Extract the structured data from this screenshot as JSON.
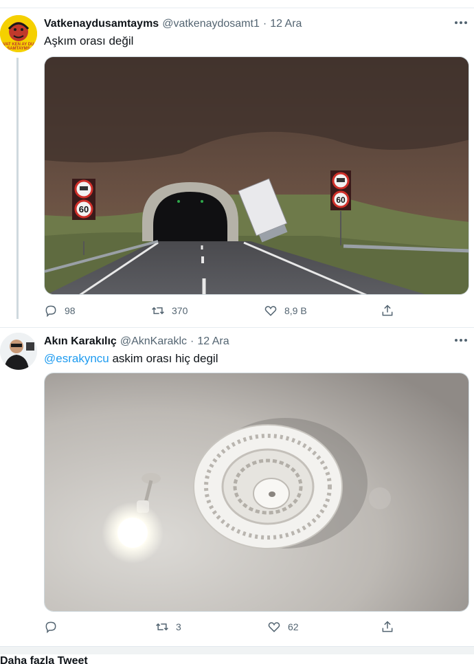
{
  "tweets": [
    {
      "name": "Vatkenaydusamtayms",
      "handle": "@vatkenaydosamt1",
      "dot": "·",
      "time": "12 Ara",
      "text": "Aşkım orası değil",
      "avatar_text": "VAT KEN AY DU SAMTAYMS",
      "stats": {
        "replies": "98",
        "retweets": "370",
        "likes": "8,9 B"
      }
    },
    {
      "name": "Akın Karakılıç",
      "handle": "@AknKaraklc",
      "dot": "·",
      "time": "12 Ara",
      "mention": "@esrakyncu",
      "text": " askim orası hiç degil",
      "stats": {
        "replies": "",
        "retweets": "3",
        "likes": "62"
      }
    }
  ],
  "signs": {
    "speed_left": "60",
    "speed_right": "60"
  },
  "footer_text": "Daha fazla Tweet",
  "colors": {
    "accent": "#1d9bf0",
    "secondary_text": "#536471",
    "border": "#cfd9de"
  },
  "icons": [
    "reply-icon",
    "retweet-icon",
    "like-icon",
    "share-icon",
    "more-icon"
  ]
}
